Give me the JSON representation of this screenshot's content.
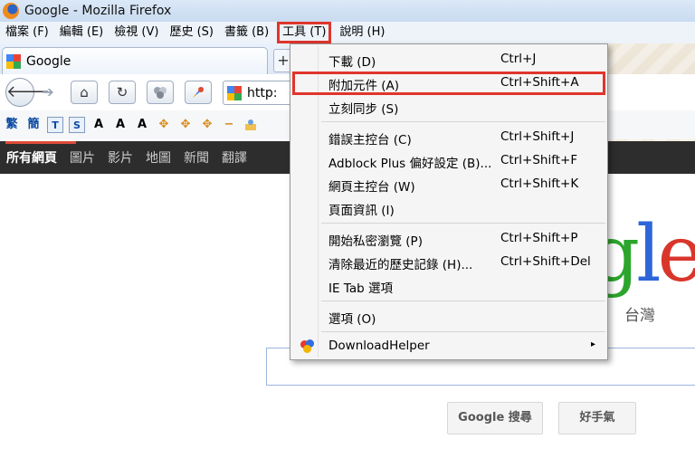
{
  "window": {
    "title": "Google - Mozilla Firefox"
  },
  "menubar": [
    {
      "label": "檔案 (F)"
    },
    {
      "label": "編輯 (E)"
    },
    {
      "label": "檢視 (V)"
    },
    {
      "label": "歷史 (S)"
    },
    {
      "label": "書籤 (B)"
    },
    {
      "label": "工具 (T)"
    },
    {
      "label": "說明 (H)"
    }
  ],
  "tab": {
    "title": "Google",
    "new_tab_symbol": "+"
  },
  "navbar": {
    "back_symbol": "🡐",
    "forward_symbol": "➔",
    "home_symbol": "⌂",
    "reload_symbol": "↻",
    "url": "http:"
  },
  "addons": [
    "繁",
    "簡",
    "T",
    "S",
    "A",
    "A",
    "A",
    "✥",
    "✥",
    "✥",
    "−"
  ],
  "google_bar": [
    "所有網頁",
    "圖片",
    "影片",
    "地圖",
    "新聞",
    "翻譯"
  ],
  "google": {
    "logo_partial": {
      "g": "g",
      "l": "l",
      "e": "e"
    },
    "region": "台灣",
    "search_button": "Google 搜尋",
    "lucky_button": "好手氣"
  },
  "tools_menu": {
    "items": [
      {
        "label": "下載 (D)",
        "shortcut": "Ctrl+J"
      },
      {
        "label": "附加元件 (A)",
        "shortcut": "Ctrl+Shift+A"
      },
      {
        "label": "立刻同步 (S)",
        "shortcut": ""
      },
      {
        "label": "錯誤主控台 (C)",
        "shortcut": "Ctrl+Shift+J"
      },
      {
        "label": "Adblock Plus 偏好設定 (B)...",
        "shortcut": "Ctrl+Shift+F"
      },
      {
        "label": "網頁主控台 (W)",
        "shortcut": "Ctrl+Shift+K"
      },
      {
        "label": "頁面資訊 (I)",
        "shortcut": ""
      },
      {
        "label": "開始私密瀏覽 (P)",
        "shortcut": "Ctrl+Shift+P"
      },
      {
        "label": "清除最近的歷史記錄 (H)...",
        "shortcut": "Ctrl+Shift+Del"
      },
      {
        "label": "IE Tab 選項",
        "shortcut": ""
      },
      {
        "label": "選項 (O)",
        "shortcut": ""
      },
      {
        "label": "DownloadHelper",
        "shortcut": "",
        "submenu_symbol": "▸"
      }
    ]
  },
  "colors": {
    "highlight": "#e0352b",
    "google_bar": "#2d2d2d"
  }
}
